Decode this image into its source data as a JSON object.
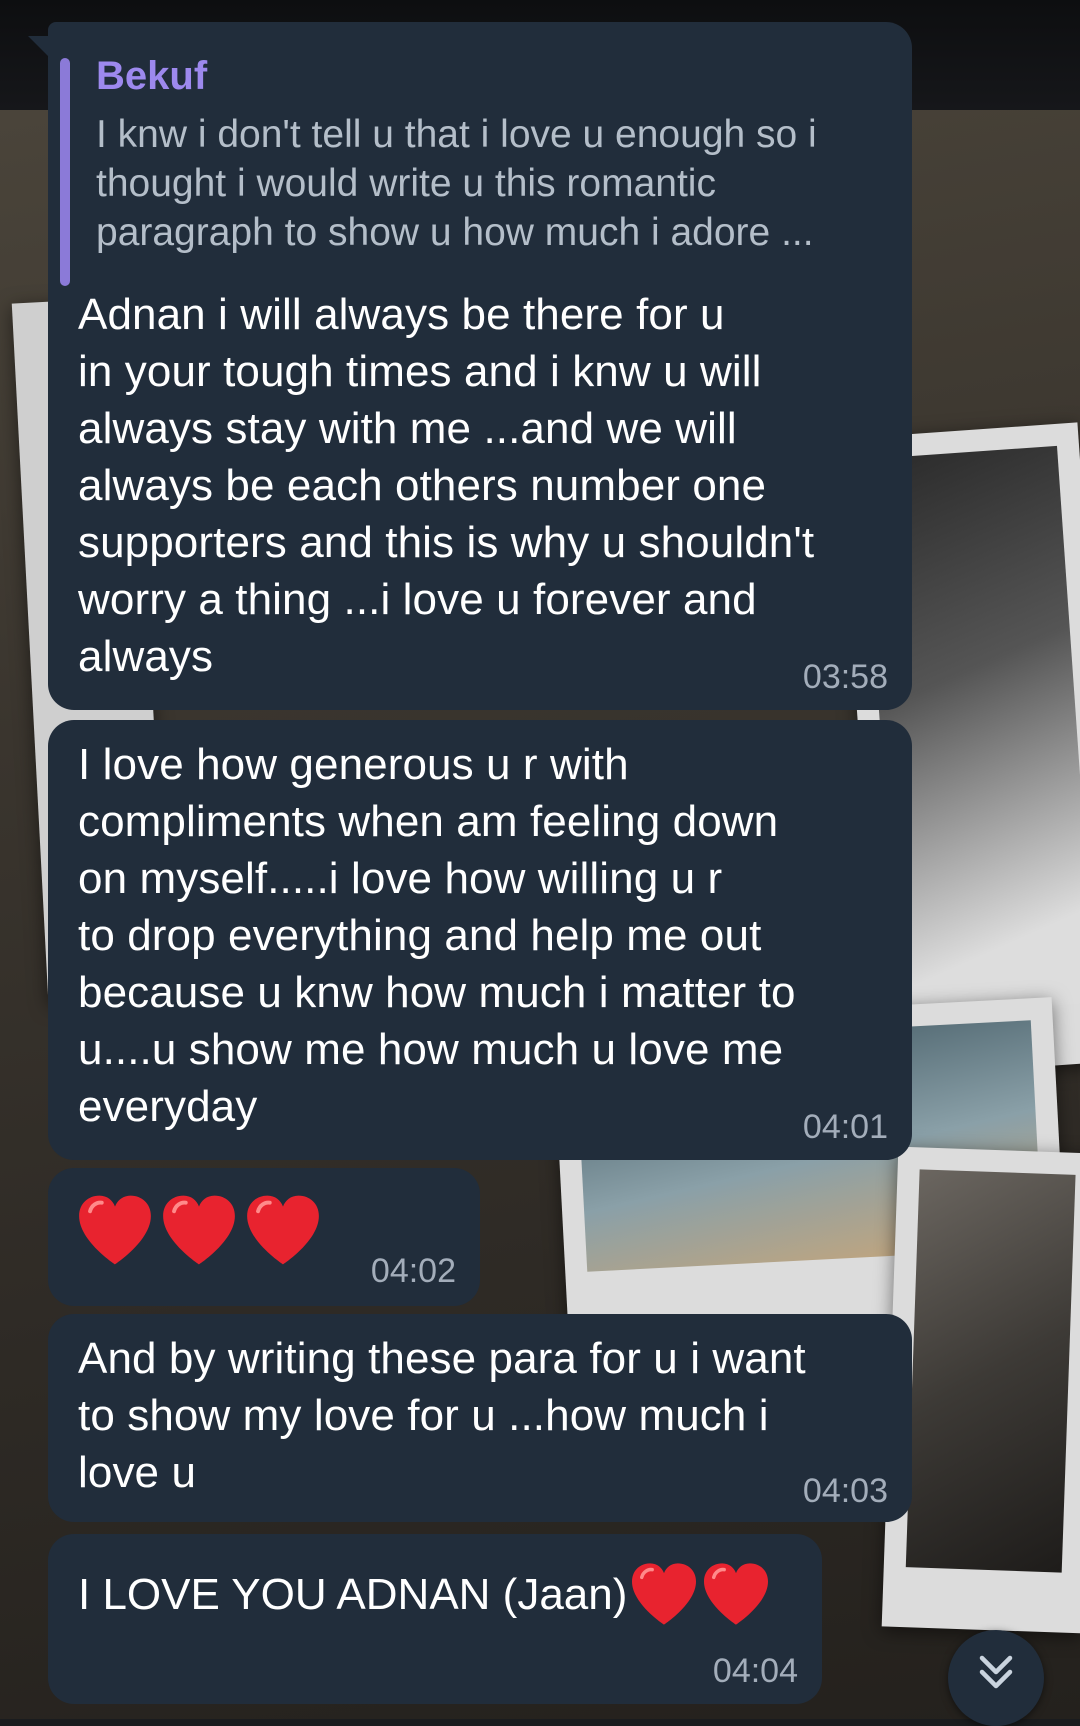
{
  "messages": [
    {
      "reply": {
        "sender": "Bekuf",
        "quote": "I knw i don't tell u that i love u enough so i thought i would write u this romantic paragraph to show u how much i adore ..."
      },
      "text": "Adnan i will always be there for u\nin your tough times and i knw u will\nalways stay with me ...and we will\nalways be each others number one\nsupporters and this is why u shouldn't\nworry a thing ...i love u forever and\nalways",
      "time": "03:58"
    },
    {
      "text": "I love how generous u r with\ncompliments when am feeling down\non myself.....i love how willing u r\nto drop everything and help me out\nbecause u knw how much i matter to\nu....u show me how much u love me\neveryday",
      "time": "04:01"
    },
    {
      "emoji": [
        "red-heart",
        "red-heart",
        "red-heart"
      ],
      "time": "04:02"
    },
    {
      "text": "And by writing these para for u i want\nto show my love for u ...how much i\nlove u",
      "time": "04:03"
    },
    {
      "text": "I LOVE YOU ADNAN (Jaan)",
      "emoji": [
        "red-heart",
        "red-heart"
      ],
      "time": "04:04"
    }
  ],
  "icons": {
    "scroll_down": "double-chevron-down-icon"
  },
  "colors": {
    "bubble": "#212d3b",
    "reply_accent": "#8b7ad8",
    "reply_name": "#9d89ee",
    "time": "#a3adba",
    "heart": "#e8232f"
  }
}
